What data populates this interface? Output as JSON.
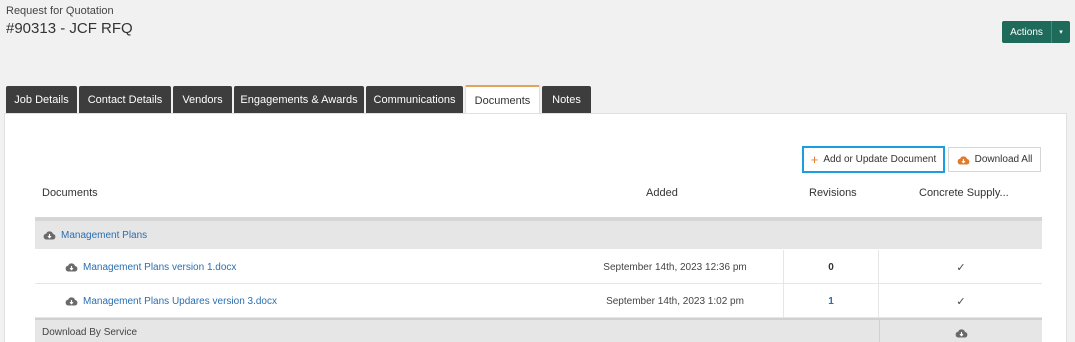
{
  "header": {
    "subtitle": "Request for Quotation",
    "title": "#90313 - JCF RFQ"
  },
  "actions": {
    "label": "Actions",
    "caret": "▾"
  },
  "tabs": [
    {
      "label": "Job Details"
    },
    {
      "label": "Contact Details"
    },
    {
      "label": "Vendors"
    },
    {
      "label": "Engagements & Awards"
    },
    {
      "label": "Communications"
    },
    {
      "label": "Documents",
      "active": true
    },
    {
      "label": "Notes"
    }
  ],
  "toolbar": {
    "add_plus": "+",
    "add_label": "Add or Update Document",
    "download_all_label": "Download All"
  },
  "table": {
    "headers": {
      "documents": "Documents",
      "added": "Added",
      "revisions": "Revisions",
      "vendor": "Concrete Supply..."
    },
    "group": {
      "label": "Management Plans"
    },
    "rows": [
      {
        "name": "Management Plans version 1.docx",
        "added": "September 14th, 2023 12:36 pm",
        "revisions": "0",
        "check": "✓"
      },
      {
        "name": "Management Plans Updares version 3.docx",
        "added": "September 14th, 2023 1:02 pm",
        "revisions": "1",
        "check": "✓"
      }
    ],
    "service_row": {
      "label": "Download By Service"
    }
  },
  "colors": {
    "accent": "#1e6b5c",
    "link": "#2a6fb0",
    "highlight": "#1a9ee0",
    "orange": "#e07a2e"
  },
  "icons": {
    "cloud": "cloud-download-icon",
    "plus": "plus-icon"
  }
}
